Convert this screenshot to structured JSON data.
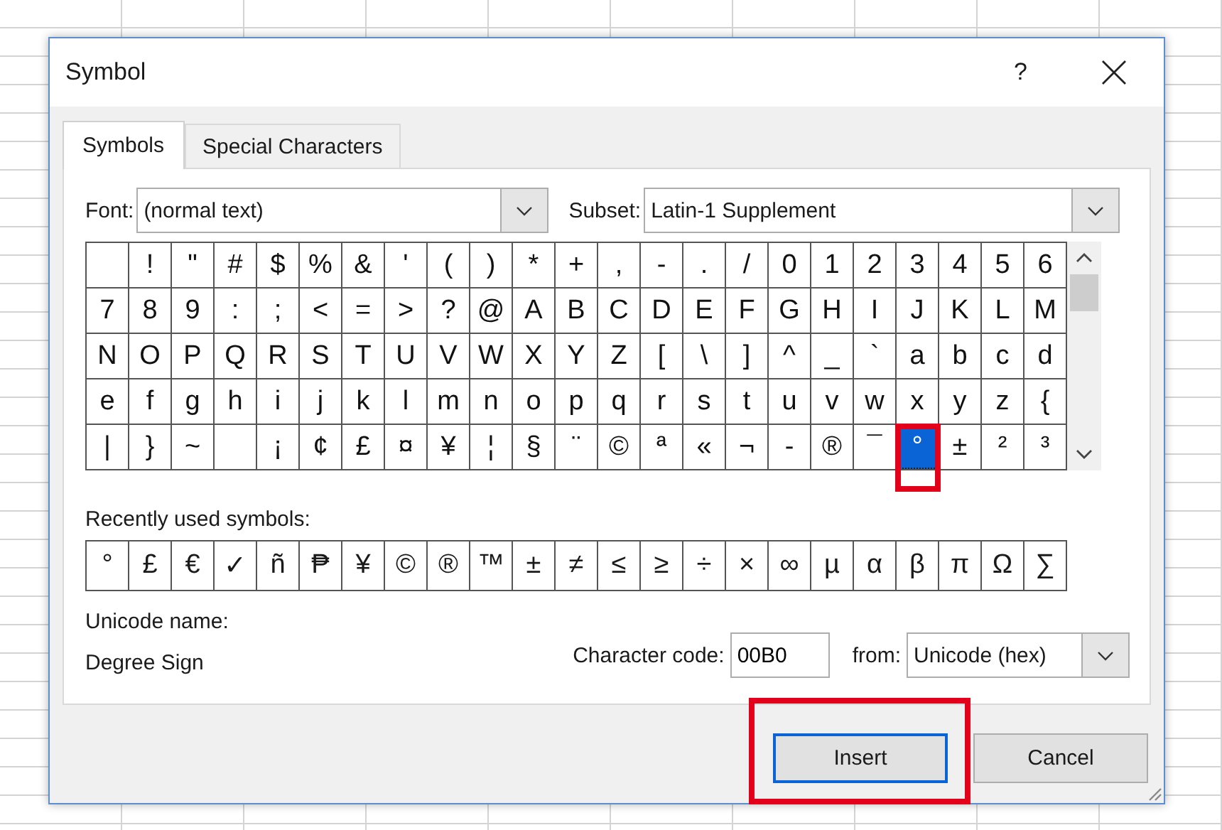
{
  "window": {
    "title": "Symbol",
    "help": "?"
  },
  "tabs": [
    {
      "label": "Symbols",
      "selected": true
    },
    {
      "label": "Special Characters",
      "selected": false
    }
  ],
  "font": {
    "label": "Font:",
    "value": "(normal text)"
  },
  "subset": {
    "label": "Subset:",
    "value": "Latin-1 Supplement"
  },
  "grid": {
    "selection_highlighted": true,
    "rows": [
      [
        {
          "selected": false
        },
        {
          "char": "!",
          "selected": false
        },
        {
          "char": "\"",
          "selected": false
        },
        {
          "char": "#",
          "selected": false
        },
        {
          "char": "$",
          "selected": false
        },
        {
          "char": "%",
          "selected": false
        },
        {
          "char": "&",
          "selected": false
        },
        {
          "char": "'",
          "selected": false
        },
        {
          "char": "(",
          "selected": false
        },
        {
          "char": ")",
          "selected": false
        },
        {
          "char": "*",
          "selected": false
        },
        {
          "char": "+",
          "selected": false
        },
        {
          "char": ",",
          "selected": false
        },
        {
          "char": "-",
          "selected": false
        },
        {
          "char": ".",
          "selected": false
        },
        {
          "char": "/",
          "selected": false
        },
        {
          "char": "0",
          "selected": false
        },
        {
          "char": "1",
          "selected": false
        },
        {
          "char": "2",
          "selected": false
        },
        {
          "char": "3",
          "selected": false
        },
        {
          "char": "4",
          "selected": false
        },
        {
          "char": "5",
          "selected": false
        },
        {
          "char": "6",
          "selected": false
        }
      ],
      [
        {
          "char": "7",
          "selected": false
        },
        {
          "char": "8",
          "selected": false
        },
        {
          "char": "9",
          "selected": false
        },
        {
          "char": ":",
          "selected": false
        },
        {
          "char": ";",
          "selected": false
        },
        {
          "char": "<",
          "selected": false
        },
        {
          "char": "=",
          "selected": false
        },
        {
          "char": ">",
          "selected": false
        },
        {
          "char": "?",
          "selected": false
        },
        {
          "char": "@",
          "selected": false
        },
        {
          "char": "A",
          "selected": false
        },
        {
          "char": "B",
          "selected": false
        },
        {
          "char": "C",
          "selected": false
        },
        {
          "char": "D",
          "selected": false
        },
        {
          "char": "E",
          "selected": false
        },
        {
          "char": "F",
          "selected": false
        },
        {
          "char": "G",
          "selected": false
        },
        {
          "char": "H",
          "selected": false
        },
        {
          "char": "I",
          "selected": false
        },
        {
          "char": "J",
          "selected": false
        },
        {
          "char": "K",
          "selected": false
        },
        {
          "char": "L",
          "selected": false
        },
        {
          "char": "M",
          "selected": false
        }
      ],
      [
        {
          "char": "N",
          "selected": false
        },
        {
          "char": "O",
          "selected": false
        },
        {
          "char": "P",
          "selected": false
        },
        {
          "char": "Q",
          "selected": false
        },
        {
          "char": "R",
          "selected": false
        },
        {
          "char": "S",
          "selected": false
        },
        {
          "char": "T",
          "selected": false
        },
        {
          "char": "U",
          "selected": false
        },
        {
          "char": "V",
          "selected": false
        },
        {
          "char": "W",
          "selected": false
        },
        {
          "char": "X",
          "selected": false
        },
        {
          "char": "Y",
          "selected": false
        },
        {
          "char": "Z",
          "selected": false
        },
        {
          "char": "[",
          "selected": false
        },
        {
          "char": "\\",
          "selected": false
        },
        {
          "char": "]",
          "selected": false
        },
        {
          "char": "^",
          "selected": false
        },
        {
          "char": "_",
          "selected": false
        },
        {
          "char": "`",
          "selected": false
        },
        {
          "char": "a",
          "selected": false
        },
        {
          "char": "b",
          "selected": false
        },
        {
          "char": "c",
          "selected": false
        },
        {
          "char": "d",
          "selected": false
        }
      ],
      [
        {
          "char": "e",
          "selected": false
        },
        {
          "char": "f",
          "selected": false
        },
        {
          "char": "g",
          "selected": false
        },
        {
          "char": "h",
          "selected": false
        },
        {
          "char": "i",
          "selected": false
        },
        {
          "char": "j",
          "selected": false
        },
        {
          "char": "k",
          "selected": false
        },
        {
          "char": "l",
          "selected": false
        },
        {
          "char": "m",
          "selected": false
        },
        {
          "char": "n",
          "selected": false
        },
        {
          "char": "o",
          "selected": false
        },
        {
          "char": "p",
          "selected": false
        },
        {
          "char": "q",
          "selected": false
        },
        {
          "char": "r",
          "selected": false
        },
        {
          "char": "s",
          "selected": false
        },
        {
          "char": "t",
          "selected": false
        },
        {
          "char": "u",
          "selected": false
        },
        {
          "char": "v",
          "selected": false
        },
        {
          "char": "w",
          "selected": false
        },
        {
          "char": "x",
          "selected": false
        },
        {
          "char": "y",
          "selected": false
        },
        {
          "char": "z",
          "selected": false
        },
        {
          "char": "{",
          "selected": false
        }
      ],
      [
        {
          "char": "|",
          "selected": false
        },
        {
          "char": "}",
          "selected": false
        },
        {
          "char": "~",
          "selected": false
        },
        {
          "selected": false
        },
        {
          "char": "¡",
          "selected": false
        },
        {
          "char": "¢",
          "selected": false
        },
        {
          "char": "£",
          "selected": false
        },
        {
          "char": "¤",
          "selected": false
        },
        {
          "char": "¥",
          "selected": false
        },
        {
          "char": "¦",
          "selected": false
        },
        {
          "char": "§",
          "selected": false
        },
        {
          "char": "¨",
          "selected": false
        },
        {
          "char": "©",
          "selected": false
        },
        {
          "char": "ª",
          "selected": false
        },
        {
          "char": "«",
          "selected": false
        },
        {
          "char": "¬",
          "selected": false
        },
        {
          "char": "-",
          "selected": false
        },
        {
          "char": "®",
          "selected": false
        },
        {
          "char": "¯",
          "selected": false
        },
        {
          "char": "°",
          "selected": true
        },
        {
          "char": "±",
          "selected": false
        },
        {
          "char": "²",
          "selected": false
        },
        {
          "char": "³",
          "selected": false
        }
      ]
    ]
  },
  "recent": {
    "label": "Recently used symbols:",
    "symbols": [
      "°",
      "£",
      "€",
      "✓",
      "ñ",
      "₱",
      "¥",
      "©",
      "®",
      "™",
      "±",
      "≠",
      "≤",
      "≥",
      "÷",
      "×",
      "∞",
      "µ",
      "α",
      "β",
      "π",
      "Ω",
      "∑"
    ]
  },
  "unicode_name": {
    "label": "Unicode name:",
    "value": "Degree Sign"
  },
  "character_code": {
    "label": "Character code:",
    "value": "00B0"
  },
  "from": {
    "label": "from:",
    "value": "Unicode (hex)"
  },
  "buttons": [
    {
      "label": "Insert",
      "default": true,
      "highlighted": true
    },
    {
      "label": "Cancel",
      "default": false,
      "highlighted": false
    }
  ]
}
